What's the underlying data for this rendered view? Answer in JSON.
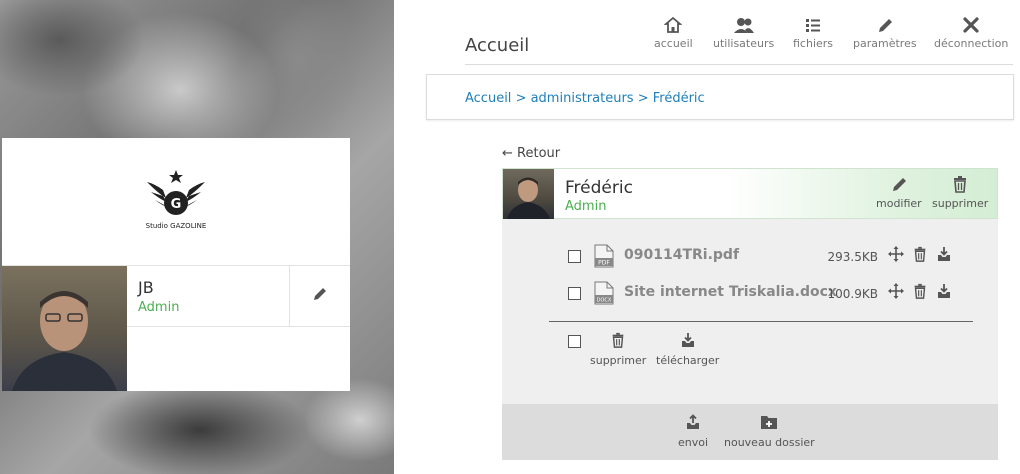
{
  "brand": {
    "logo_text": "Studio GAZOLINE"
  },
  "user_card": {
    "name": "JB",
    "role": "Admin"
  },
  "header": {
    "title": "Accueil",
    "nav": [
      {
        "label": "accueil",
        "icon": "home-icon"
      },
      {
        "label": "utilisateurs",
        "icon": "users-icon"
      },
      {
        "label": "fichiers",
        "icon": "list-icon"
      },
      {
        "label": "paramètres",
        "icon": "pencil-icon"
      },
      {
        "label": "déconnection",
        "icon": "close-icon"
      }
    ]
  },
  "breadcrumb": [
    "Accueil",
    "administrateurs",
    "Frédéric"
  ],
  "back_label": "← Retour",
  "detail": {
    "name": "Frédéric",
    "role": "Admin",
    "modify_label": "modifier",
    "delete_label": "supprimer"
  },
  "files": [
    {
      "name": "090114TRi.pdf",
      "size": "293.5KB",
      "type": "PDF"
    },
    {
      "name": "Site internet Triskalia.docx",
      "size": "100.9KB",
      "type": "DOCX"
    }
  ],
  "bulk_actions": {
    "delete_label": "supprimer",
    "download_label": "télécharger"
  },
  "footer_actions": {
    "upload_label": "envoi",
    "new_folder_label": "nouveau dossier"
  },
  "colors": {
    "link": "#1f7fb8",
    "role": "#4caf50"
  }
}
